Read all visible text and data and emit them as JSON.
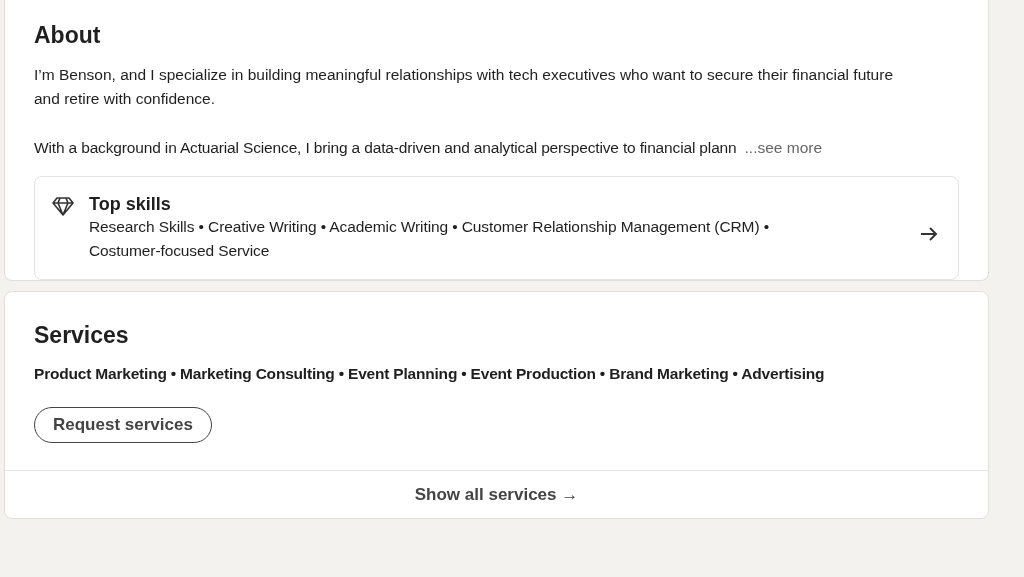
{
  "about": {
    "title": "About",
    "paragraphs": [
      "I’m Benson, and I specialize in building meaningful relationships with tech executives who want to secure their financial future and retire with confidence.",
      "With a background in Actuarial Science, I bring a data-driven and analytical perspective to financial plann"
    ],
    "see_more": "...see more",
    "top_skills": {
      "title": "Top skills",
      "lines": [
        "Research Skills • Creative Writing • Academic Writing • Customer Relationship Management (CRM) •",
        "Costumer-focused Service"
      ]
    }
  },
  "services": {
    "title": "Services",
    "list": "Product Marketing • Marketing Consulting • Event Planning • Event Production • Brand Marketing • Advertising",
    "request_button": "Request services",
    "show_all": "Show all services →"
  }
}
